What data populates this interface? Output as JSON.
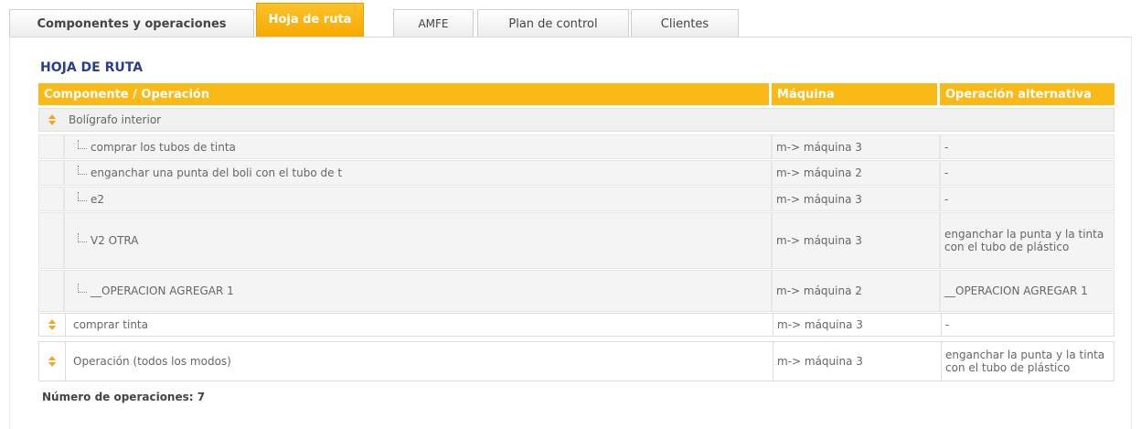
{
  "tabs": [
    {
      "label": "Componentes y operaciones",
      "active": false
    },
    {
      "label": "Hoja de ruta",
      "active": true
    },
    {
      "label": "AMFE",
      "active": false
    },
    {
      "label": "Plan de control",
      "active": false
    },
    {
      "label": "Clientes",
      "active": false
    }
  ],
  "section_title": "HOJA DE RUTA",
  "table": {
    "headers": [
      "Componente / Operación",
      "Máquina",
      "Operación alternativa"
    ],
    "group": {
      "name": "Bolígrafo interior",
      "children": [
        {
          "op": "comprar los tubos de tinta",
          "machine": "m-> máquina 3",
          "alt": "-"
        },
        {
          "op": "enganchar una punta del boli con el tubo de t",
          "machine": "m-> máquina 2",
          "alt": "-"
        },
        {
          "op": "e2",
          "machine": "m-> máquina 3",
          "alt": "-"
        },
        {
          "op": "V2 OTRA",
          "machine": "m-> máquina 3",
          "alt": "enganchar la punta y la tinta con el tubo de plástico"
        },
        {
          "op": "__OPERACION AGREGAR 1",
          "machine": "m-> máquina 2",
          "alt": "__OPERACION AGREGAR 1"
        }
      ]
    },
    "rows": [
      {
        "op": "comprar  tinta",
        "machine": "m-> máquina 3",
        "alt": "-"
      },
      {
        "op": "Operación  (todos los modos)",
        "machine": "m-> máquina 3",
        "alt": "enganchar la punta y la tinta con el tubo de plástico"
      }
    ]
  },
  "footer": "Número de operaciones: 7",
  "colors": {
    "accent": "#fab917",
    "title": "#2a3e8c",
    "expand_icon": "#f3a51c"
  }
}
